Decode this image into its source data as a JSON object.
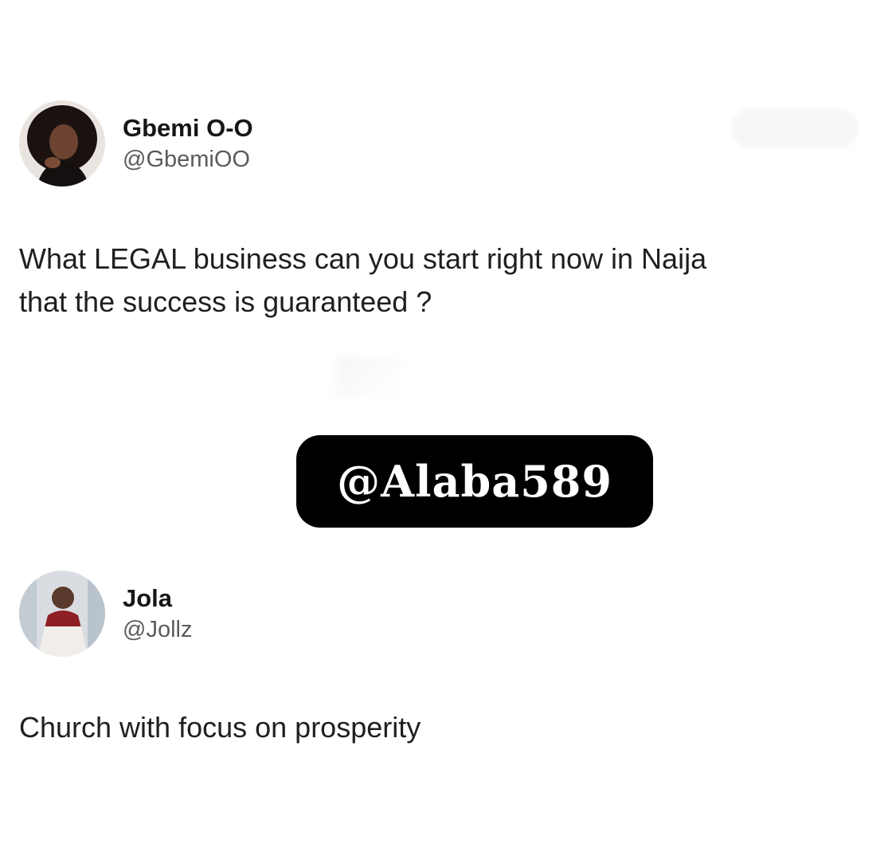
{
  "original_tweet": {
    "display_name": "Gbemi O-O",
    "handle": "@GbemiOO",
    "text": "What LEGAL business can you start right now in Naija\nthat the success is guaranteed ?",
    "avatar_icon": "profile-photo-icon"
  },
  "reply_tweet": {
    "display_name": "Jola",
    "handle": "@Jollz",
    "text": "Church with focus on prosperity",
    "avatar_icon": "profile-photo-icon"
  },
  "watermark": {
    "text": "@Alaba589"
  },
  "colors": {
    "background": "#ffffff",
    "watermark_bg": "#000000",
    "watermark_text": "#ffffff",
    "handle_gray": "#5b5b5b"
  }
}
